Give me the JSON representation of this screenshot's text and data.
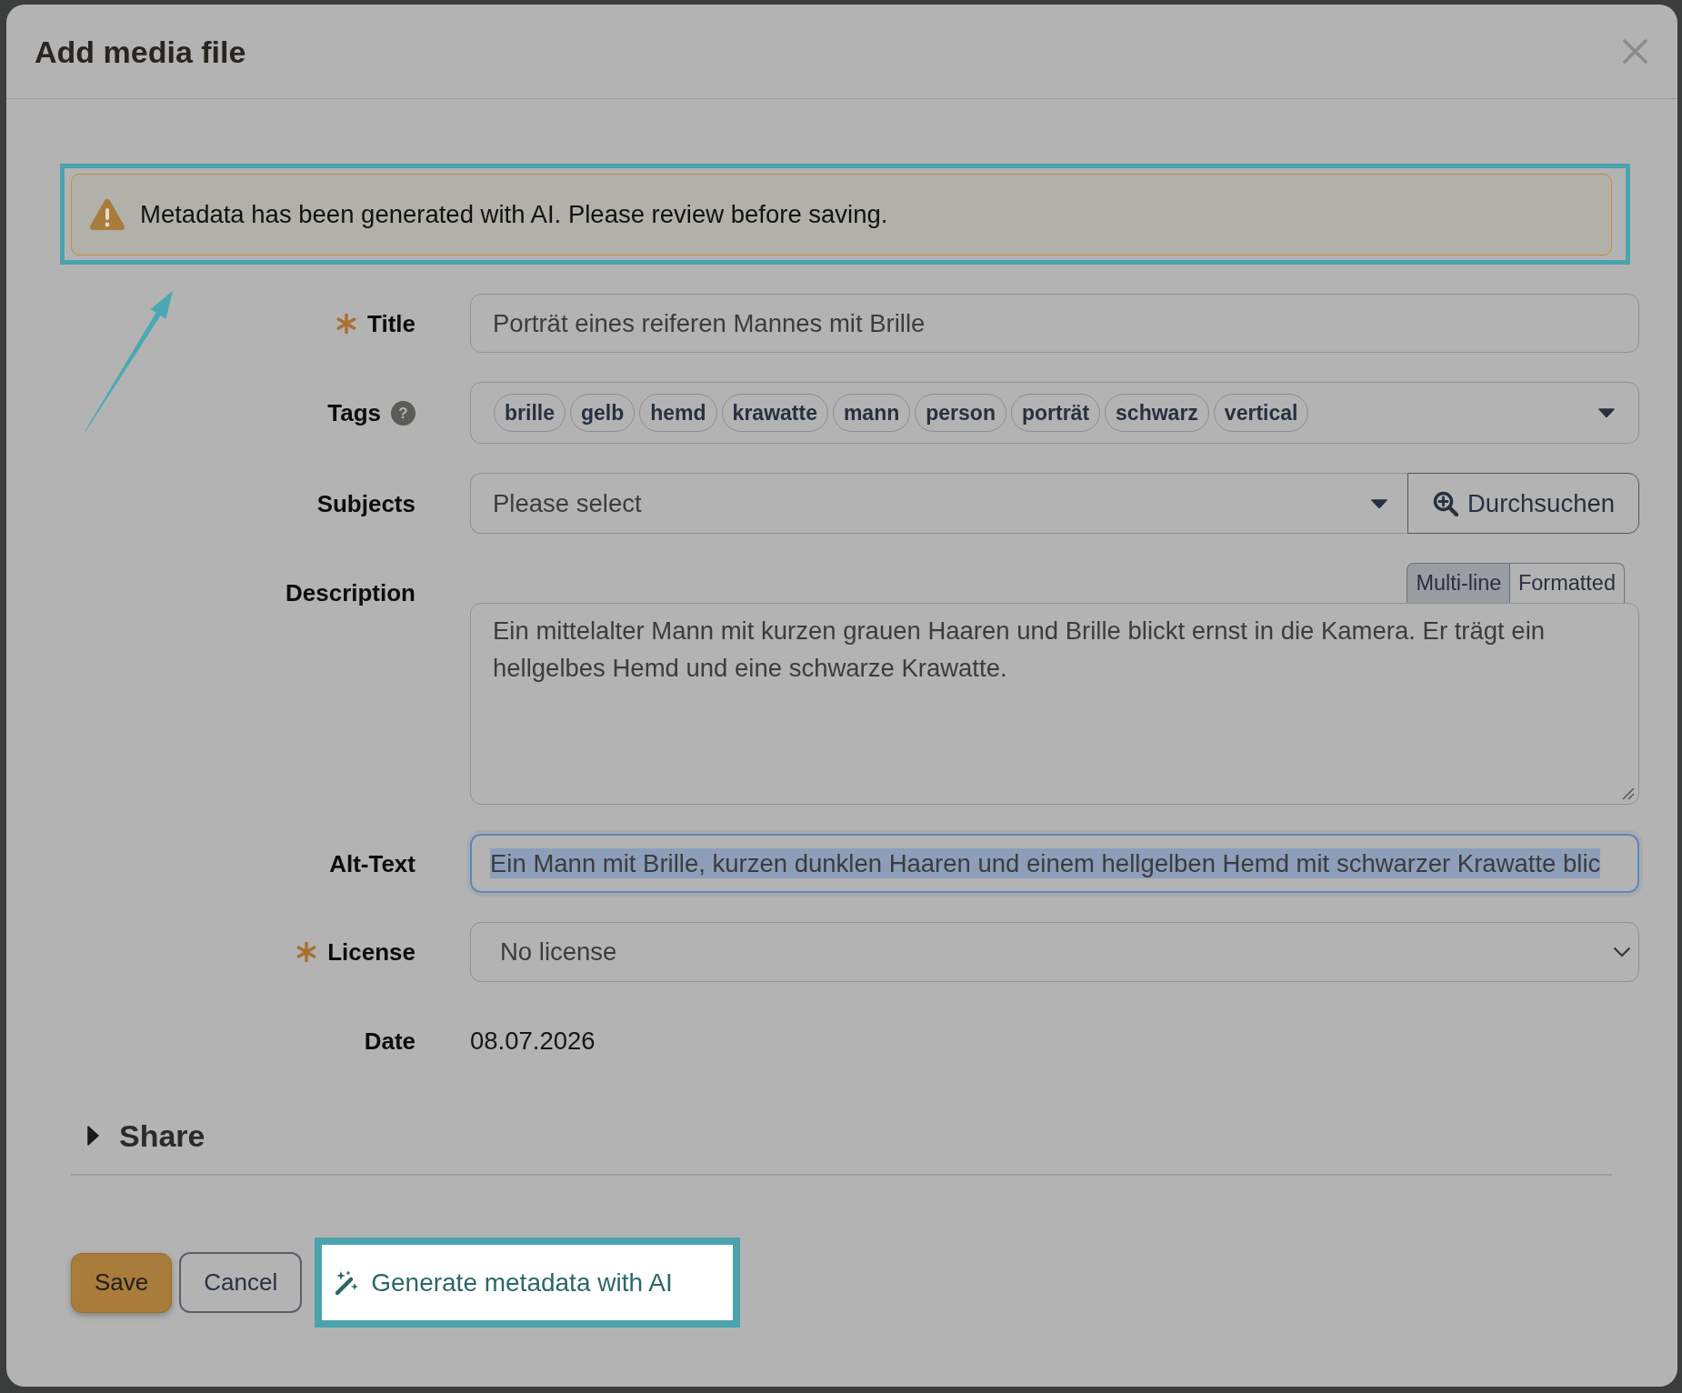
{
  "dialog": {
    "title": "Add media file"
  },
  "alert": {
    "text": "Metadata has been generated with AI. Please review before saving.",
    "highlighted": true
  },
  "form": {
    "fields": [
      {
        "kind": "text",
        "label": "Title",
        "required": true,
        "value": "Porträt eines reiferen Mannes mit Brille"
      },
      {
        "kind": "tags",
        "label": "Tags",
        "required": false,
        "help": "?",
        "tags": [
          "brille",
          "gelb",
          "hemd",
          "krawatte",
          "mann",
          "person",
          "porträt",
          "schwarz",
          "vertical"
        ]
      },
      {
        "kind": "search_select",
        "label": "Subjects",
        "required": false,
        "placeholder": "Please select",
        "button": "Durchsuchen"
      },
      {
        "kind": "textarea",
        "label": "Description",
        "required": false,
        "modes": [
          {
            "label": "Multi-line",
            "selected": true
          },
          {
            "label": "Formatted",
            "selected": false
          }
        ],
        "value": "Ein mittelalter Mann mit kurzen grauen Haaren und Brille blickt ernst in die Kamera. Er trägt ein hellgelbes Hemd und eine schwarze Krawatte."
      },
      {
        "kind": "text",
        "label": "Alt-Text",
        "required": false,
        "focused": true,
        "text_selected": true,
        "value": "Ein Mann mit Brille, kurzen dunklen Haaren und einem hellgelben Hemd mit schwarzer Krawatte blic"
      },
      {
        "kind": "select",
        "label": "License",
        "required": true,
        "value": "No license"
      },
      {
        "kind": "static",
        "label": "Date",
        "required": false,
        "value": "08.07.2026"
      }
    ]
  },
  "share": {
    "label": "Share",
    "expanded": false
  },
  "buttons": [
    {
      "kind": "primary",
      "label": "Save"
    },
    {
      "kind": "secondary",
      "label": "Cancel"
    },
    {
      "kind": "ai",
      "label": "Generate metadata with AI",
      "highlighted": true
    }
  ]
}
